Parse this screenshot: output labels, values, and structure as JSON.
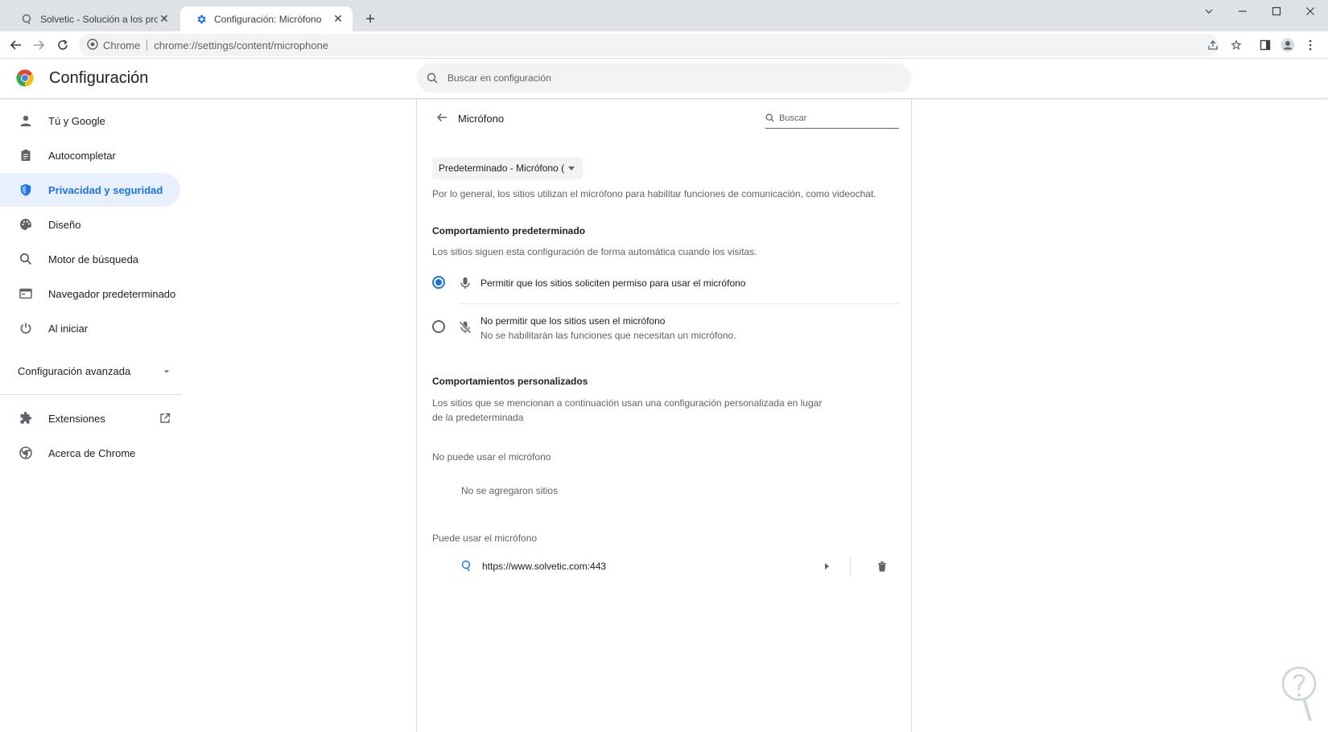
{
  "browser": {
    "tabs": [
      {
        "title": "Solvetic - Solución a los problem",
        "favicon": "solvetic-icon",
        "active": false
      },
      {
        "title": "Configuración: Micrófono",
        "favicon": "gear-icon",
        "active": true
      }
    ],
    "new_tab_label": "+",
    "omnibox": {
      "site_label": "Chrome",
      "url": "chrome://settings/content/microphone"
    }
  },
  "settings": {
    "title": "Configuración",
    "search_placeholder": "Buscar en configuración"
  },
  "sidebar": {
    "items": [
      {
        "label": "Tú y Google",
        "icon": "person-icon"
      },
      {
        "label": "Autocompletar",
        "icon": "clipboard-icon"
      },
      {
        "label": "Privacidad y seguridad",
        "icon": "shield-icon",
        "selected": true
      },
      {
        "label": "Diseño",
        "icon": "palette-icon"
      },
      {
        "label": "Motor de búsqueda",
        "icon": "search-icon"
      },
      {
        "label": "Navegador predeterminado",
        "icon": "browser-icon"
      },
      {
        "label": "Al iniciar",
        "icon": "power-icon"
      }
    ],
    "advanced_label": "Configuración avanzada",
    "extensions_label": "Extensiones",
    "about_label": "Acerca de Chrome"
  },
  "microphone": {
    "page_title": "Micrófono",
    "search_placeholder": "Buscar",
    "device_select_value": "Predeterminado - Micrófono (",
    "intro": "Por lo general, los sitios utilizan el micrófono para habilitar funciones de comunicación, como videochat.",
    "default_behavior": {
      "title": "Comportamiento predeterminado",
      "description": "Los sitios siguen esta configuración de forma automática cuando los visitas.",
      "options": [
        {
          "label": "Permitir que los sitios soliciten permiso para usar el micrófono",
          "sub": "",
          "checked": true,
          "icon": "mic-icon"
        },
        {
          "label": "No permitir que los sitios usen el micrófono",
          "sub": "No se habilitarán las funciones que necesitan un micrófono.",
          "checked": false,
          "icon": "mic-off-icon"
        }
      ]
    },
    "custom_behavior": {
      "title": "Comportamientos personalizados",
      "description": "Los sitios que se mencionan a continuación usan una configuración personalizada en lugar de la predeterminada",
      "blocked_label": "No puede usar el micrófono",
      "blocked_empty": "No se agregaron sitios",
      "allowed_label": "Puede usar el micrófono",
      "allowed_sites": [
        "https://www.solvetic.com:443"
      ]
    }
  },
  "colors": {
    "accent": "#1a73e8",
    "selected_bg": "#e8f0fe",
    "tabstrip_bg": "#dee1e6"
  }
}
